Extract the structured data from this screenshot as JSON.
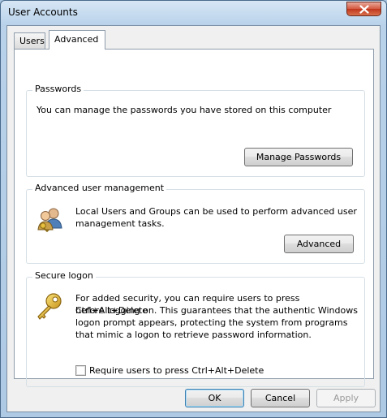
{
  "window": {
    "title": "User Accounts"
  },
  "tabs": [
    {
      "label": "Users"
    },
    {
      "label": "Advanced",
      "selected": true
    }
  ],
  "passwords": {
    "title": "Passwords",
    "description": "You can manage the passwords you have stored on this computer",
    "button_label": "Manage Passwords"
  },
  "advanced_user_management": {
    "title": "Advanced user management",
    "description_line1": "Local Users and Groups can be used to perform advanced user",
    "description_line2": "management tasks.",
    "button_label": "Advanced",
    "icon": "users-icon"
  },
  "secure_logon": {
    "title": "Secure logon",
    "description_lines": [
      "For added security, you can require users to press Ctrl+Alt+Delete",
      "before logging on. This guarantees that the authentic Windows",
      "logon prompt appears, protecting the system from programs",
      "that mimic a logon to retrieve password information."
    ],
    "checkbox_label": "Require users to press Ctrl+Alt+Delete",
    "checkbox_checked": false,
    "icon": "key-icon"
  },
  "footer": {
    "ok_label": "OK",
    "cancel_label": "Cancel",
    "apply_label": "Apply",
    "apply_enabled": false
  }
}
